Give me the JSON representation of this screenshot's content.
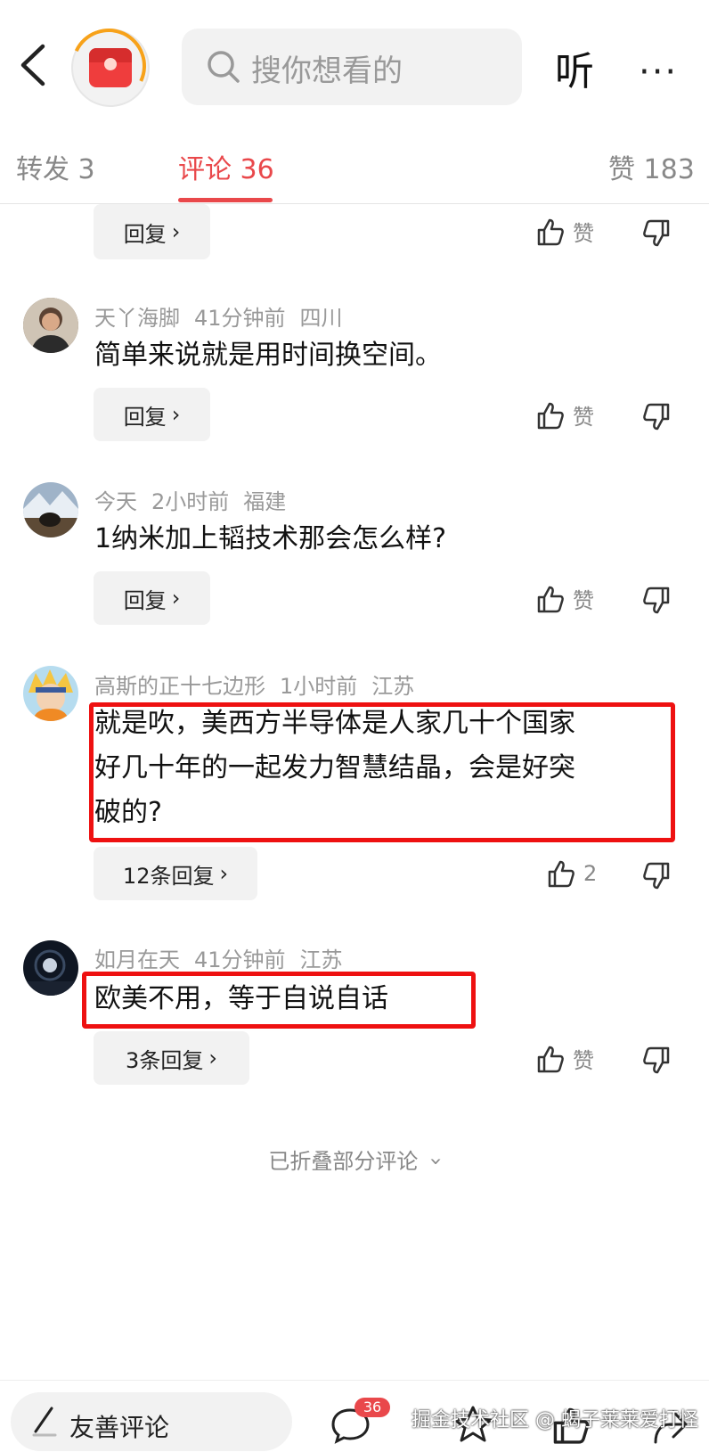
{
  "header": {
    "search_placeholder": "搜你想看的",
    "listen_label": "听",
    "more_label": "···"
  },
  "tabs": {
    "forward": "转发 3",
    "comment": "评论 36",
    "like": "赞 183"
  },
  "comments": [
    {
      "reply": "回复"
    },
    {
      "user": "天丫海脚",
      "time": "41分钟前",
      "region": "四川",
      "text": "简单来说就是用时间换空间。",
      "reply": "回复",
      "likes": "赞"
    },
    {
      "user": "今天",
      "time": "2小时前",
      "region": "福建",
      "text": "1纳米加上韬技术那会怎么样?",
      "reply": "回复",
      "likes": "赞"
    },
    {
      "user": "高斯的正十七边形",
      "time": "1小时前",
      "region": "江苏",
      "text_lines": [
        "就是吹，美西方半导体是人家几十个国家",
        "好几十年的一起发力智慧结晶，会是好突",
        "破的?"
      ],
      "reply": "12条回复",
      "likes": "2"
    },
    {
      "user": "如月在天",
      "time": "41分钟前",
      "region": "江苏",
      "text": "欧美不用，等于自说自话",
      "reply": "3条回复",
      "likes": "赞"
    }
  ],
  "folded_label": "已折叠部分评论",
  "bottom": {
    "input_label": "友善评论",
    "comment_count": "36",
    "watermark": "掘金技术社区 @ 蝎子莱莱爱打怪"
  },
  "colors": {
    "accent": "#e9484b",
    "highlight_box": "#ee1111"
  }
}
